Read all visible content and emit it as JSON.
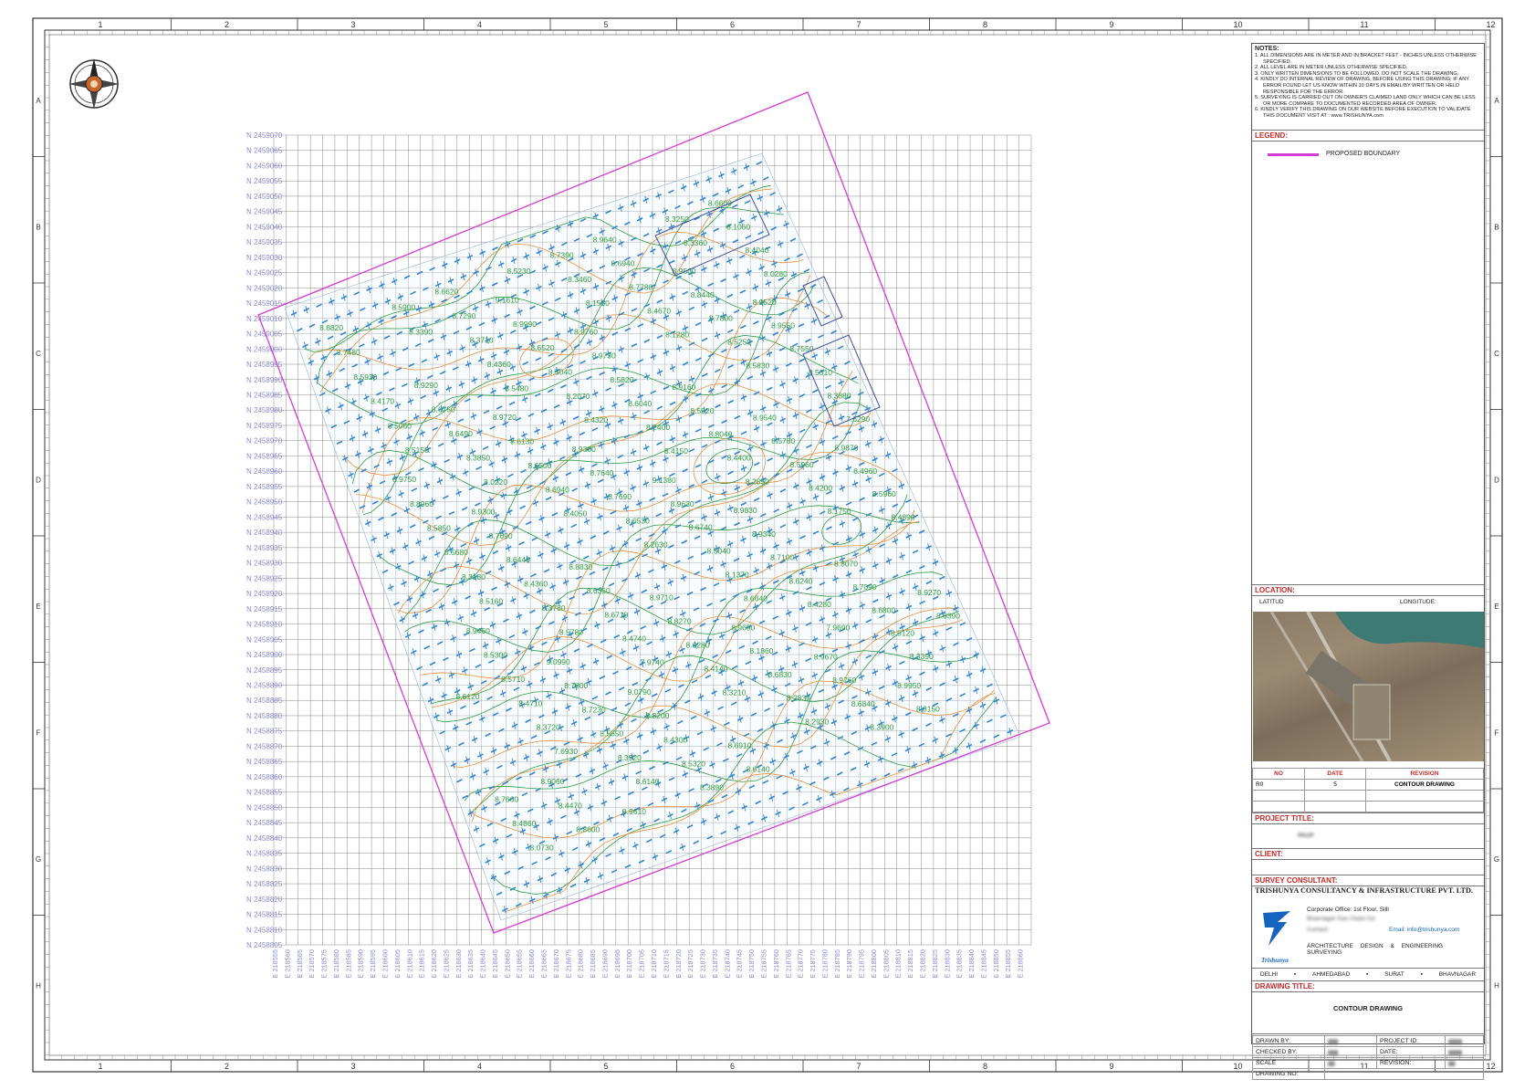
{
  "border": {
    "column_numbers": [
      "1",
      "2",
      "3",
      "4",
      "5",
      "6",
      "7",
      "8",
      "9",
      "10",
      "11",
      "12"
    ],
    "row_letters": [
      "A",
      "B",
      "C",
      "D",
      "E",
      "F",
      "G",
      "H"
    ]
  },
  "colors": {
    "boundary": "#d63ad6",
    "contour_green": "#2e9e3e",
    "contour_orange": "#e8913a",
    "spot_blue": "#2f84d6",
    "grid": "#7a7a7a",
    "coord_label": "#8a8ad6",
    "building": "#3a4fa8",
    "section_title": "#c62828"
  },
  "compass": {
    "icon": "compass-rose-icon"
  },
  "drawing": {
    "northing_labels": [
      "N 2459070",
      "N 2459065",
      "N 2459060",
      "N 2459055",
      "N 2459050",
      "N 2459045",
      "N 2459040",
      "N 2459035",
      "N 2459030",
      "N 2459025",
      "N 2459020",
      "N 2459015",
      "N 2459010",
      "N 2459005",
      "N 2459000",
      "N 2458995",
      "N 2458990",
      "N 2458985",
      "N 2458980",
      "N 2458975",
      "N 2458970",
      "N 2458965",
      "N 2458960",
      "N 2458955",
      "N 2458950",
      "N 2458945",
      "N 2458940",
      "N 2458935",
      "N 2458930",
      "N 2458925",
      "N 2458920",
      "N 2458915",
      "N 2458910",
      "N 2458905",
      "N 2458900",
      "N 2458895",
      "N 2458890",
      "N 2458885",
      "N 2458880",
      "N 2458875",
      "N 2458870",
      "N 2458865",
      "N 2458860",
      "N 2458855",
      "N 2458850",
      "N 2458845",
      "N 2458840",
      "N 2458835",
      "N 2458830",
      "N 2458825",
      "N 2458820",
      "N 2458815",
      "N 2458810",
      "N 2458805"
    ],
    "easting_labels": [
      "E 218555",
      "E 218560",
      "E 218565",
      "E 218570",
      "E 218575",
      "E 218580",
      "E 218585",
      "E 218590",
      "E 218595",
      "E 218600",
      "E 218605",
      "E 218610",
      "E 218615",
      "E 218620",
      "E 218625",
      "E 218630",
      "E 218635",
      "E 218640",
      "E 218645",
      "E 218650",
      "E 218655",
      "E 218660",
      "E 218665",
      "E 218670",
      "E 218675",
      "E 218680",
      "E 218685",
      "E 218690",
      "E 218695",
      "E 218700",
      "E 218705",
      "E 218710",
      "E 218715",
      "E 218720",
      "E 218725",
      "E 218730",
      "E 218735",
      "E 218740",
      "E 218745",
      "E 218750",
      "E 218755",
      "E 218760",
      "E 218765",
      "E 218770",
      "E 218775",
      "E 218780",
      "E 218785",
      "E 218790",
      "E 218795",
      "E 218800",
      "E 218805",
      "E 218810",
      "E 218815",
      "E 218820",
      "E 218825",
      "E 218830",
      "E 218835",
      "E 218840",
      "E 218845",
      "E 218850",
      "E 218855",
      "E 218860"
    ],
    "contour_labels": [
      "8.8820",
      "8.9300",
      "9.0790",
      "8.9760",
      "8.9830",
      "8.9950",
      "8.9750",
      "9.0990",
      "9.1610",
      "9.1380",
      "8.9670",
      "8.9520",
      "8.9460",
      "8.9610",
      "8.9300",
      "8.9690",
      "8.9500",
      "8.9870",
      "8.9060",
      "8.9720",
      "8.9710",
      "8.9640",
      "8.9540",
      "8.9270",
      "8.9290",
      "8.8830",
      "8.6910",
      "8.9160",
      "8.8070",
      "8.7480",
      "8.7690",
      "8.8200",
      "8.9730",
      "8.9340",
      "8.8150",
      "8.8960",
      "8.7800",
      "8.9990",
      "8.9630",
      "8.9760",
      "8.9550",
      "8.5300",
      "8.6620",
      "8.7640",
      "8.1860",
      "8.8440",
      "8.4960",
      "8.4470",
      "8.6130",
      "8.8270",
      "8.6940",
      "8.5780",
      "8.8390",
      "8.6750",
      "8.6350",
      "8.6140",
      "8.5920",
      "8.7090",
      "8.5930",
      "8.6440",
      "8.4300",
      "8.5820",
      "8.7100",
      "8.6600",
      "8.5850",
      "8.7230",
      "8.6520",
      "8.6740",
      "8.6840",
      "8.7550",
      "8.5710",
      "8.7290",
      "8.7690",
      "8.6830",
      "8.7800",
      "8.5960",
      "8.8600",
      "8.6500",
      "8.6280",
      "8.7780",
      "8.5960",
      "8.7660",
      "8.6490",
      "8.6710",
      "8.7390",
      "8.8040",
      "8.6800",
      "8.4170",
      "8.4360",
      "8.5320",
      "8.6040",
      "8.6240",
      "8.1060",
      "8.5680",
      "8.5650",
      "8.5040",
      "8.5040",
      "8.3900",
      "8.5310",
      "8.4710",
      "8.3710",
      "8.6530",
      "8.2830",
      "8.5250",
      "8.4890",
      "8.5900",
      "8.6940",
      "8.4140",
      "8.4670",
      "8.4200",
      "8.4860",
      "8.3850",
      "8.4740",
      "8.3460",
      "8.4400",
      "8.5120",
      "8.5060",
      "8.3780",
      "8.3890",
      "8.2400",
      "8.4280",
      "8.4040",
      "8.3180",
      "8.3920",
      "8.2070",
      "8.1370",
      "8.3250",
      "8.3880",
      "8.3720",
      "8.4360",
      "8.2630",
      "8.2930",
      "8.5830",
      "8.6120",
      "8.3390",
      "8.4050",
      "8.3210",
      "8.1280",
      "8.1750",
      "8.0730",
      "8.0220",
      "7.9740",
      "8.1550",
      "8.2850",
      "8.3390",
      "8.5150",
      "8.5780",
      "8.5230",
      "8.4150",
      "7.9690",
      "8.0280",
      "8.5160",
      "8.6140",
      "8.4320",
      "8.6640",
      "8.3360",
      "7.6290",
      "7.6930",
      "8.5480"
    ],
    "north_arrow_note": ""
  },
  "panel": {
    "notes_title": "NOTES:",
    "notes": [
      "1.  ALL DIMENSIONS ARE IN METER AND IN BRACKET FEET - INCHES UNLESS OTHERWISE SPECIFIED.",
      "2.  ALL LEVEL ARE IN METER UNLESS OTHERWISE SPECIFIED.",
      "3.  ONLY WRITTEN DIMENSIONS TO BE FOLLOWED. DO NOT SCALE THE DRAWING.",
      "4.  KINDLY DO INTERNAL REVIEW OF DRAWING, BEFORE USING THIS DRAWING; IF ANY ERROR FOUND LET US KNOW WITHIN 10 DAYS IN EMAIL/BY WRITTEN OR HELD RESPONSIBLE FOR THE ERROR.",
      "5.  SURVEYING IS CARRIED OUT ON OWNER'S CLAIMED LAND ONLY WHICH CAN BE LESS OR MORE COMPARE TO DOCUMENTED RECORDED AREA OF OWNER.",
      "6.  KINDLY VERIFY THIS DRAWING ON OUR WEBSITE BEFORE EXECUTION TO VALIDATE THIS DOCUMENT VISIT AT : www.TRISHUNYA.com"
    ],
    "legend_title": "LEGEND:",
    "legend_item": "PROPOSED BOUNDARY",
    "location_title": "LOCATION:",
    "latitude_label": "LATITUD",
    "longitude_label": "LONGITUDE:",
    "rev_headers": {
      "no": "NO",
      "date": "DATE",
      "revision": "REVISION"
    },
    "rev_row": {
      "no": "R0",
      "date": "5",
      "revision": "CONTOUR DRAWING"
    },
    "project_title_label": "PROJECT TITLE:",
    "project_title_value": "PAUP",
    "client_label": "CLIENT:",
    "survey_consultant_label": "SURVEY CONSULTANT:",
    "company_name": "TRISHUNYA CONSULTANCY & INFRASTRUCTURE PVT. LTD.",
    "corporate_office": "Corporate Office: 1st Floor, Silll",
    "address_line": "Bhavnagar Gas Ckata Ga",
    "contact_line": "Contact:",
    "email": "Email: info@trishunya.com",
    "logo_text": "Trishunya",
    "services": [
      "ARCHITECTURE",
      "DESIGN & ENGINEERING",
      "SURVEYING"
    ],
    "cities": [
      "DELHI",
      "AHMEDABAD",
      "SURAT",
      "BHAVNAGAR"
    ],
    "drawing_title_label": "DRAWING TITLE:",
    "drawing_title_value": "CONTOUR DRAWING",
    "tb": {
      "drawn_by": "DRAWN BY:",
      "checked_by": "CHECKED BY:",
      "scale": "SCALE",
      "drawing_no": "DRAWING NO:",
      "project_id": "PROJECT ID:",
      "date": "DATE:",
      "revision": "REVISION:"
    }
  }
}
